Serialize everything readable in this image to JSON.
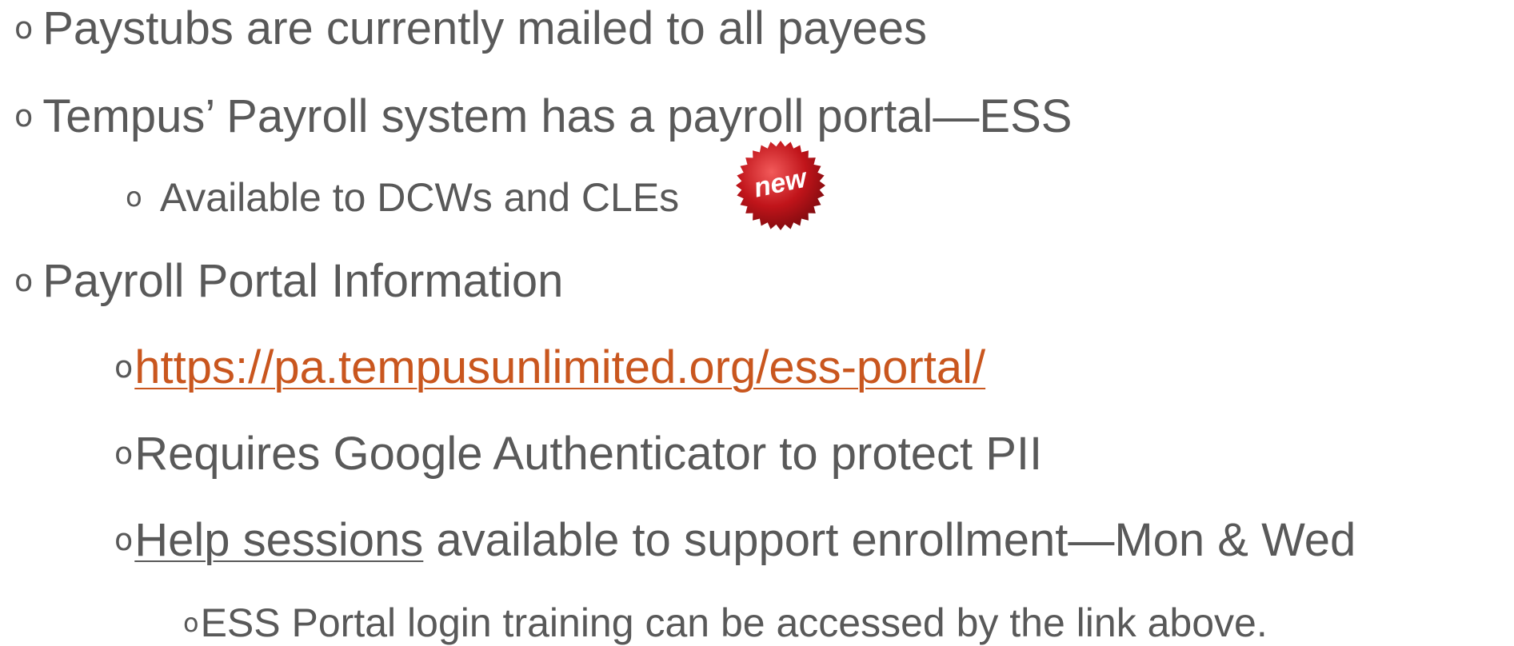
{
  "bullet_glyph": "o",
  "items": {
    "paystubs": "Paystubs are currently mailed to all payees",
    "tempus_portal": "Tempus’ Payroll system has a payroll portal—ESS",
    "available": "Available to DCWs and CLEs",
    "portal_info": "Payroll Portal Information",
    "url": "https://pa.tempusunlimited.org/ess-portal/",
    "google_auth": "Requires Google Authenticator to protect PII",
    "help_sessions_link": "Help sessions",
    "help_sessions_rest": " available to support enrollment—Mon & Wed",
    "training": "ESS Portal login training can be accessed by the link above."
  },
  "badge": {
    "text": "new",
    "color": "#c0141a",
    "icon": "new-starburst-icon"
  },
  "colors": {
    "text": "#595959",
    "link": "#c9561e"
  }
}
